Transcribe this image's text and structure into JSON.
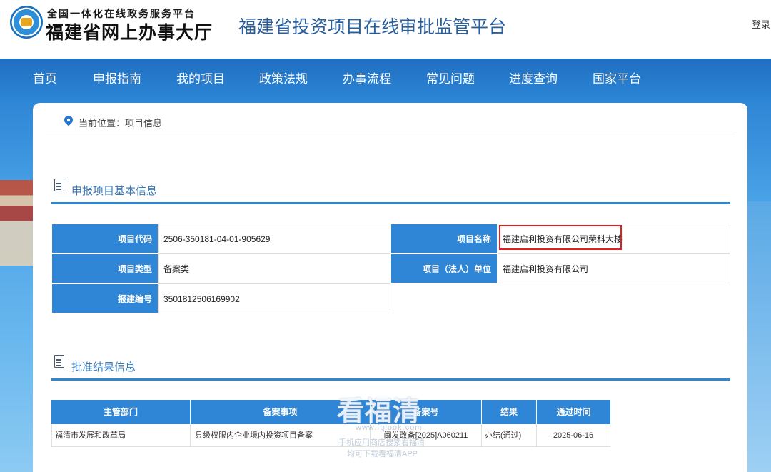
{
  "header": {
    "logo_line1": "全国一体化在线政务服务平台",
    "logo_line2": "福建省网上办事大厅",
    "site_title": "福建省投资项目在线审批监管平台",
    "login": "登录"
  },
  "nav": {
    "items": [
      "首页",
      "申报指南",
      "我的项目",
      "政策法规",
      "办事流程",
      "常见问题",
      "进度查询",
      "国家平台"
    ]
  },
  "breadcrumb": {
    "text": "当前位置：项目信息"
  },
  "basic_info": {
    "title": "申报项目基本信息",
    "fields": [
      {
        "label": "项目代码",
        "value": "2506-350181-04-01-905629"
      },
      {
        "label": "项目名称",
        "value": "福建启利投资有限公司荣科大楼"
      },
      {
        "label": "项目类型",
        "value": "备案类"
      },
      {
        "label": "项目（法人）单位",
        "value": "福建启利投资有限公司"
      },
      {
        "label": "报建编号",
        "value": "3501812506169902"
      }
    ]
  },
  "approval_result": {
    "title": "批准结果信息",
    "columns": [
      "主管部门",
      "备案事项",
      "备案号",
      "结果",
      "通过时间"
    ],
    "rows": [
      [
        "福清市发展和改革局",
        "县级权限内企业境内投资项目备案",
        "闽发改备[2025]A060211",
        "办结(通过)",
        "2025-06-16"
      ]
    ]
  },
  "watermark": {
    "brand": "看福清",
    "url": "www.fqlook.com",
    "line1": "手机应用商店搜索看福清",
    "line2": "均可下载看福清APP"
  },
  "colors": {
    "nav_blue": "#1f6fc1",
    "label_blue": "#2f86d6",
    "highlight_red": "#e02020"
  }
}
